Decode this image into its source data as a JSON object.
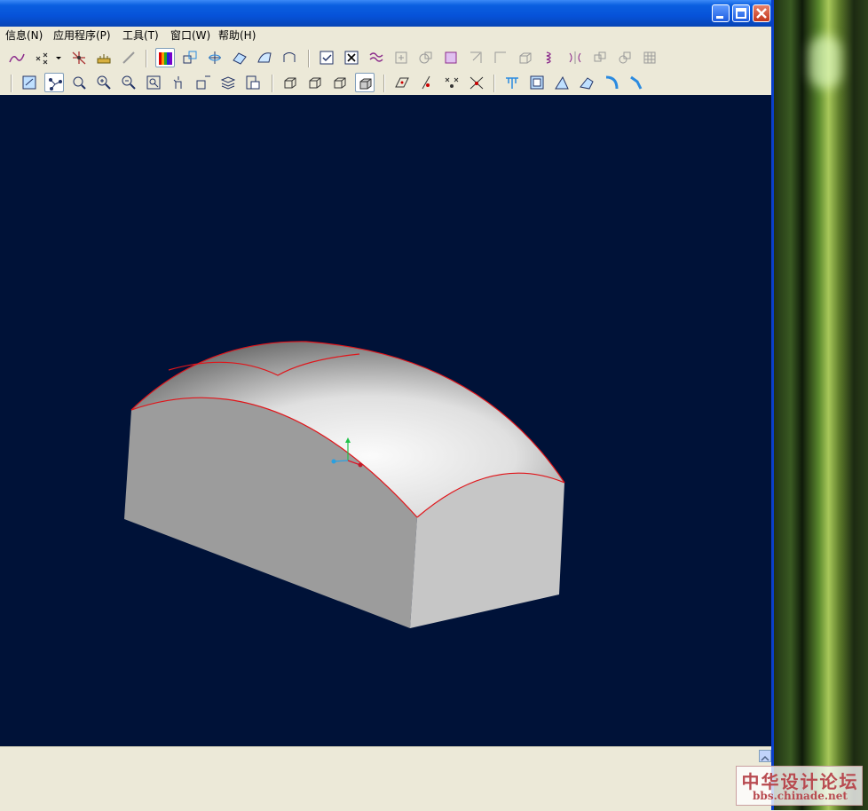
{
  "menu": {
    "items": [
      {
        "label": "信息(N)"
      },
      {
        "label": "应用程序(P)"
      },
      {
        "label": "工具(T)"
      },
      {
        "label": "窗口(W)"
      },
      {
        "label": "帮助(H)"
      }
    ]
  },
  "toolbar1": {
    "icons": [
      "curve-icon",
      "point-set-icon",
      "dropdown-arrow-icon",
      "intersect-point-icon",
      "measure-icon",
      "line-tool-icon",
      "color-map-icon",
      "transform-icon",
      "datum-axis-icon",
      "datum-plane-icon",
      "surface-icon",
      "sketch-icon",
      "list-icon",
      "delete-icon",
      "wave-icon",
      "move-icon",
      "copy-icon",
      "square-icon",
      "trim-icon",
      "rectangle-icon",
      "box-icon",
      "spring-icon",
      "mirror-icon",
      "pattern-icon",
      "offset-icon",
      "grid-icon"
    ]
  },
  "toolbar2": {
    "icons": [
      "refresh-view-icon",
      "node-icon",
      "zoom-orbit-icon",
      "zoom-in-icon",
      "zoom-out-icon",
      "zoom-fit-icon",
      "pan-icon",
      "label-icon",
      "layers-icon",
      "camera-icon",
      "iso-view-icon",
      "front-view-icon",
      "back-view-icon",
      "shaded-view-icon",
      "plane-edit-icon",
      "edit-point-icon",
      "edit-points-icon",
      "edit-curve-icon",
      "extrude-icon",
      "offset-face-icon",
      "chamfer-icon",
      "sweep-icon",
      "bend-icon",
      "blend-icon"
    ]
  },
  "window": {
    "minimize_label": "_",
    "maximize_label": "□",
    "close_label": "×"
  },
  "colors": {
    "viewport_bg": "#001238",
    "edge_red": "#e0151a",
    "titlebar_blue": "#0652d8"
  },
  "watermark": {
    "cn_text": "中华设计论坛",
    "url": "bbs.chinade.net"
  }
}
